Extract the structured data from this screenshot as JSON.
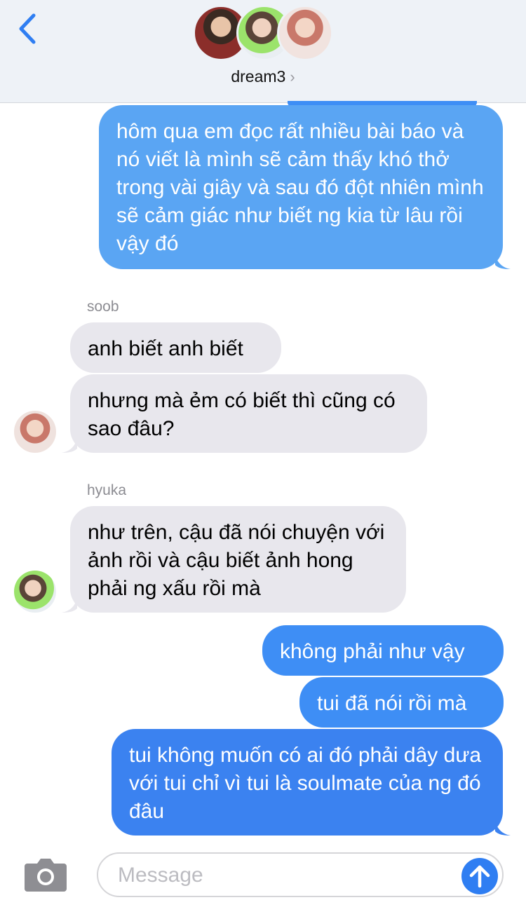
{
  "header": {
    "title": "dream3",
    "chevron": "›",
    "avatars": [
      "avatar-1",
      "avatar-2",
      "avatar-3"
    ]
  },
  "messages": [
    {
      "direction": "out",
      "text": "hôm qua em đọc rất nhiều bài báo và nó viết là mình sẽ cảm thấy khó thở trong vài giây và sau đó đột nhiên mình sẽ cảm giác như biết ng kia từ lâu rồi vậy đó"
    },
    {
      "direction": "in",
      "sender": "soob",
      "text": "anh biết anh biết"
    },
    {
      "direction": "in",
      "text": "nhưng mà ẻm có biết thì cũng có sao đâu?"
    },
    {
      "direction": "in",
      "sender": "hyuka",
      "text": "như trên, cậu đã nói chuyện với ảnh rồi và cậu biết ảnh hong phải ng xấu rồi mà"
    },
    {
      "direction": "out",
      "text": "không phải như vậy"
    },
    {
      "direction": "out",
      "text": "tui đã nói rồi mà"
    },
    {
      "direction": "out",
      "text": "tui không muốn có ai đó phải dây dưa với tui chỉ vì tui là soulmate của ng đó đâu"
    }
  ],
  "composer": {
    "placeholder": "Message",
    "camera_icon": "camera-icon",
    "send_icon": "arrow-up-icon"
  },
  "colors": {
    "outgoing": "#3e8ef5",
    "incoming": "#e8e7ed",
    "header_bg": "#eef2f7",
    "accent": "#2f7ef2"
  }
}
